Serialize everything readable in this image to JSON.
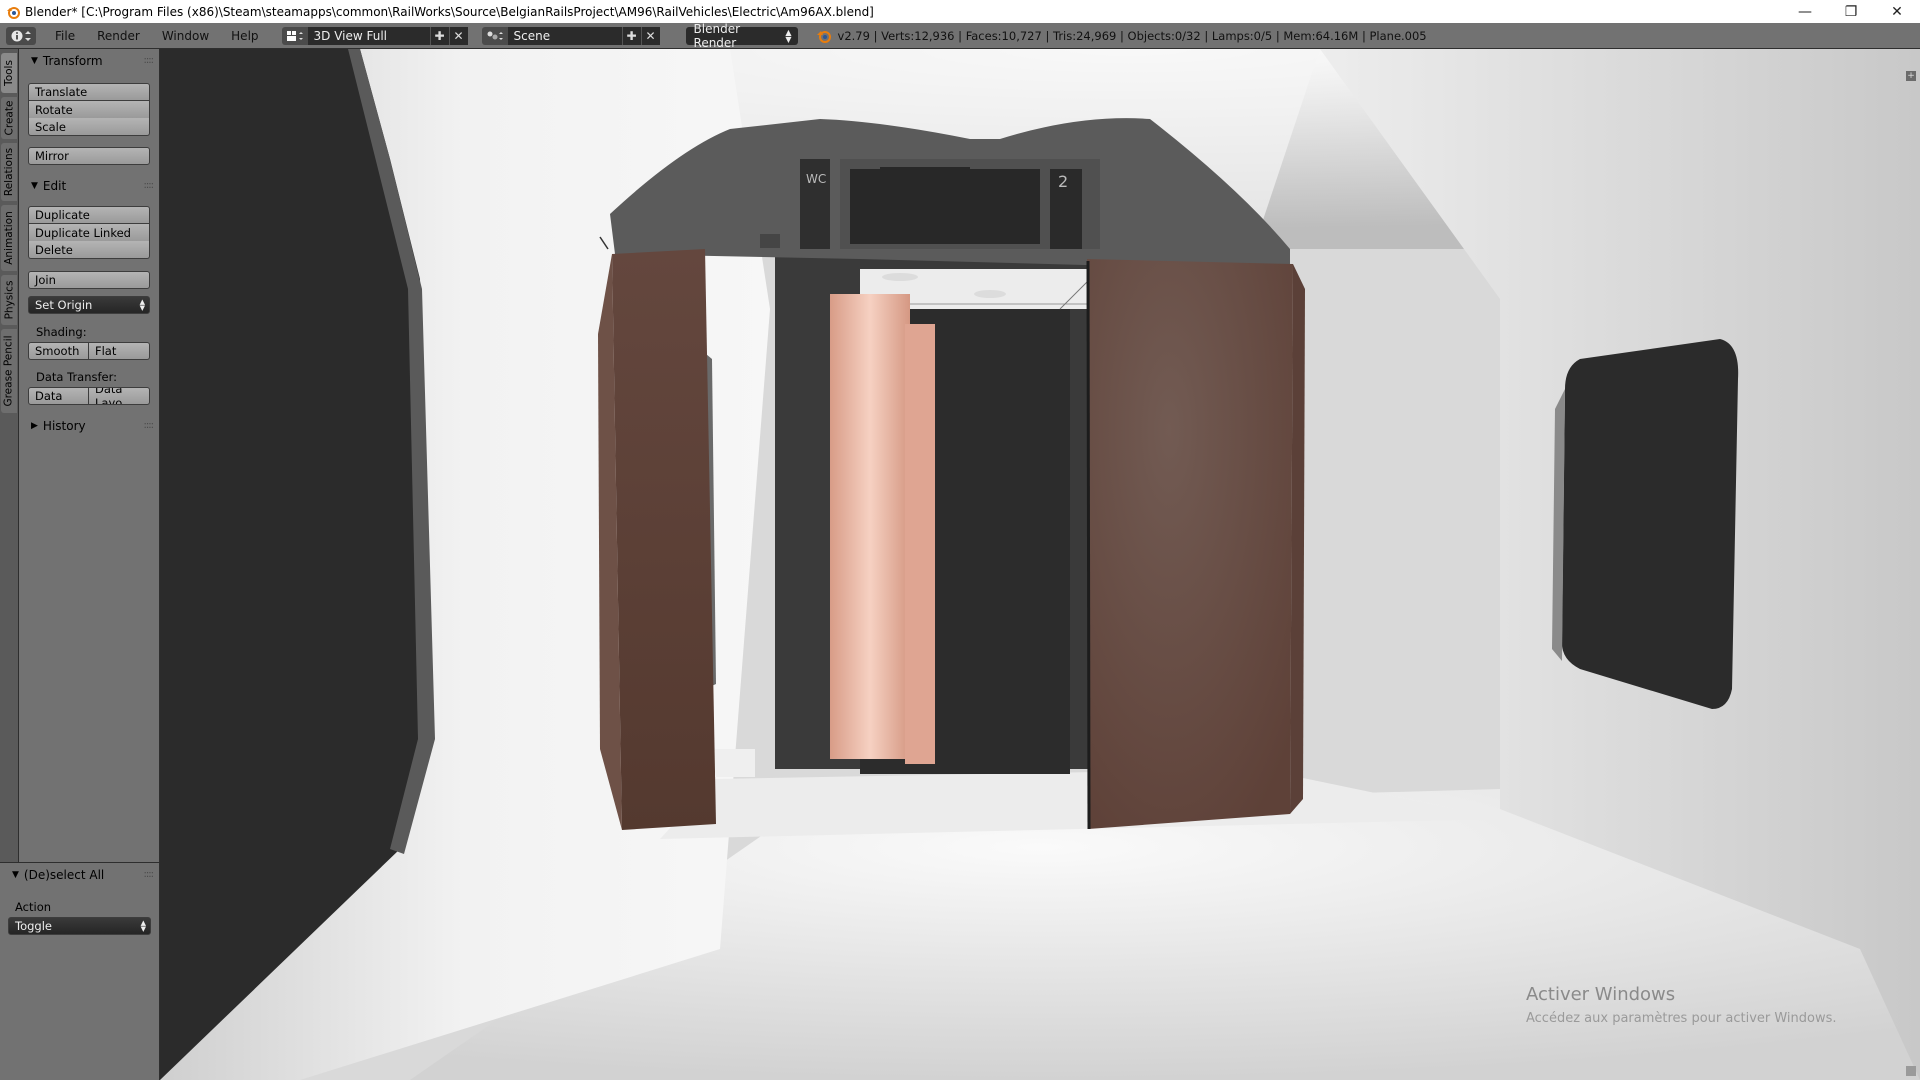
{
  "window": {
    "title": "Blender* [C:\\Program Files (x86)\\Steam\\steamapps\\common\\RailWorks\\Source\\BelgianRailsProject\\AM96\\RailVehicles\\Electric\\Am96AX.blend]",
    "minimize": "—",
    "restore": "❐",
    "close": "✕"
  },
  "menubar": {
    "menus": [
      "File",
      "Render",
      "Window",
      "Help"
    ],
    "screen_layout": "3D View Full",
    "scene": "Scene",
    "render_engine": "Blender Render",
    "stats": "v2.79 | Verts:12,936 | Faces:10,727 | Tris:24,969 | Objects:0/32 | Lamps:0/5 | Mem:64.16M | Plane.005"
  },
  "tabs": [
    "Tools",
    "Create",
    "Relations",
    "Animation",
    "Physics",
    "Grease Pencil"
  ],
  "toolshelf": {
    "transform": {
      "title": "Transform",
      "buttons": [
        "Translate",
        "Rotate",
        "Scale",
        "Mirror"
      ]
    },
    "edit": {
      "title": "Edit",
      "buttons": [
        "Duplicate",
        "Duplicate Linked",
        "Delete",
        "Join"
      ],
      "set_origin": "Set Origin",
      "shading_label": "Shading:",
      "smooth": "Smooth",
      "flat": "Flat",
      "data_transfer_label": "Data Transfer:",
      "data": "Data",
      "data_layout": "Data Layo"
    },
    "history": {
      "title": "History"
    }
  },
  "operator": {
    "title": "(De)select All",
    "action_label": "Action",
    "action_value": "Toggle"
  },
  "viewport": {
    "sign_wc": "WC",
    "sign_number": "2",
    "watermark_title": "Activer Windows",
    "watermark_sub": "Accédez aux paramètres pour activer Windows."
  },
  "colors": {
    "panel_bg": "#727272",
    "header_bg": "#727272",
    "door_brown": "#6b4d44",
    "partition_pink": "#e8b8a3"
  }
}
